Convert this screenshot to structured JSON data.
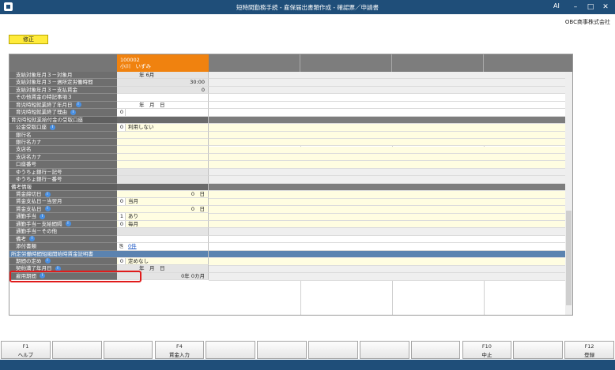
{
  "window": {
    "title": "短時間勤務手続 - 雇保届出書類作成 - 確認票／申請書",
    "company": "OBC商事株式会社",
    "ai_mark": "AI"
  },
  "mode_badge": "修正",
  "employee": {
    "code": "100002",
    "name": "小川　いずみ"
  },
  "rows": [
    {
      "label": "支給対象年月３－対象月",
      "type": "gray",
      "value": "年  6月",
      "align": "ctr"
    },
    {
      "label": "支給対象年月３－週所定労働時間",
      "type": "gray",
      "value": "30:00",
      "align": "rt"
    },
    {
      "label": "支給対象年月３－支払賃金",
      "type": "gray",
      "value": "0",
      "align": "rt"
    },
    {
      "label": "その他賃金の特記事項３",
      "type": "white",
      "value": "",
      "align": "txt"
    },
    {
      "label": "育児時短就業終了年月日",
      "type": "white",
      "info": true,
      "value": "年　月　日",
      "align": "ctr"
    },
    {
      "label": "育児時短就業終了理由",
      "type": "white",
      "info": true,
      "code": "0",
      "value": "",
      "align": "txt"
    },
    {
      "label": "育児時短就業給付金の受取口座",
      "type": "section",
      "value": "",
      "align": "txt"
    },
    {
      "label": "公金受取口座",
      "type": "yellow",
      "info": true,
      "code": "0",
      "value": "利用しない",
      "align": "txt"
    },
    {
      "label": "銀行名",
      "type": "yellow",
      "value": "",
      "align": "txt"
    },
    {
      "label": "銀行名カナ",
      "type": "yellow",
      "value": "",
      "align": "txt"
    },
    {
      "label": "支店名",
      "type": "yellow",
      "value": "",
      "align": "txt"
    },
    {
      "label": "支店名カナ",
      "type": "yellow",
      "value": "",
      "align": "txt"
    },
    {
      "label": "口座番号",
      "type": "yellow",
      "value": "",
      "align": "txt"
    },
    {
      "label": "ゆうちょ銀行－記号",
      "type": "gray",
      "value": "",
      "align": "txt"
    },
    {
      "label": "ゆうちょ銀行－番号",
      "type": "gray",
      "value": "",
      "align": "txt"
    },
    {
      "label": "備考情報",
      "type": "section",
      "value": "",
      "align": "txt"
    },
    {
      "label": "賃金締切日",
      "type": "yellow",
      "info": true,
      "value": "0　日",
      "align": "rt"
    },
    {
      "label": "賃金支払日－当翌月",
      "type": "yellow",
      "code": "0",
      "value": "当月",
      "align": "txt"
    },
    {
      "label": "賃金支払日",
      "type": "yellow",
      "info": true,
      "value": "0　日",
      "align": "rt"
    },
    {
      "label": "通勤手当",
      "type": "yellow",
      "info": true,
      "code": "1",
      "value": "あり",
      "align": "txt"
    },
    {
      "label": "通勤手当－支給間隔",
      "type": "yellow",
      "info": true,
      "code": "0",
      "value": "毎月",
      "align": "txt"
    },
    {
      "label": "通勤手当－その他",
      "type": "gray",
      "value": "",
      "align": "txt"
    },
    {
      "label": "備考",
      "type": "white",
      "info": true,
      "value": "",
      "align": "txt"
    },
    {
      "label": "添付書類",
      "type": "white",
      "value": "0件",
      "align": "txt",
      "attach": true
    },
    {
      "label": "所定労働時間短縮開始時賃金証明書",
      "type": "blue",
      "value": "",
      "align": "txt"
    },
    {
      "label": "期間の定め",
      "type": "yellow",
      "info": true,
      "code": "0",
      "value": "定めなし",
      "align": "txt"
    },
    {
      "label": "契約満了年月日",
      "type": "gray",
      "info": true,
      "value": "年　月　日",
      "align": "ctr"
    },
    {
      "label": "雇用期間",
      "type": "gray",
      "info": true,
      "value": "0年 0カ月",
      "align": "rt"
    }
  ],
  "fkeys": [
    {
      "fn": "F1",
      "label": "ヘルプ"
    },
    {
      "fn": "",
      "label": ""
    },
    {
      "fn": "",
      "label": ""
    },
    {
      "fn": "F4",
      "label": "賃金入力"
    },
    {
      "fn": "",
      "label": ""
    },
    {
      "fn": "",
      "label": ""
    },
    {
      "fn": "",
      "label": ""
    },
    {
      "fn": "",
      "label": ""
    },
    {
      "fn": "",
      "label": ""
    },
    {
      "fn": "F10",
      "label": "中止"
    },
    {
      "fn": "",
      "label": ""
    },
    {
      "fn": "F12",
      "label": "登録"
    }
  ],
  "colors": {
    "titlebar": "#1f4e79",
    "header_orange": "#f0820f",
    "badge_yellow": "#ffeb3b",
    "highlight_red": "#e01b1b"
  }
}
